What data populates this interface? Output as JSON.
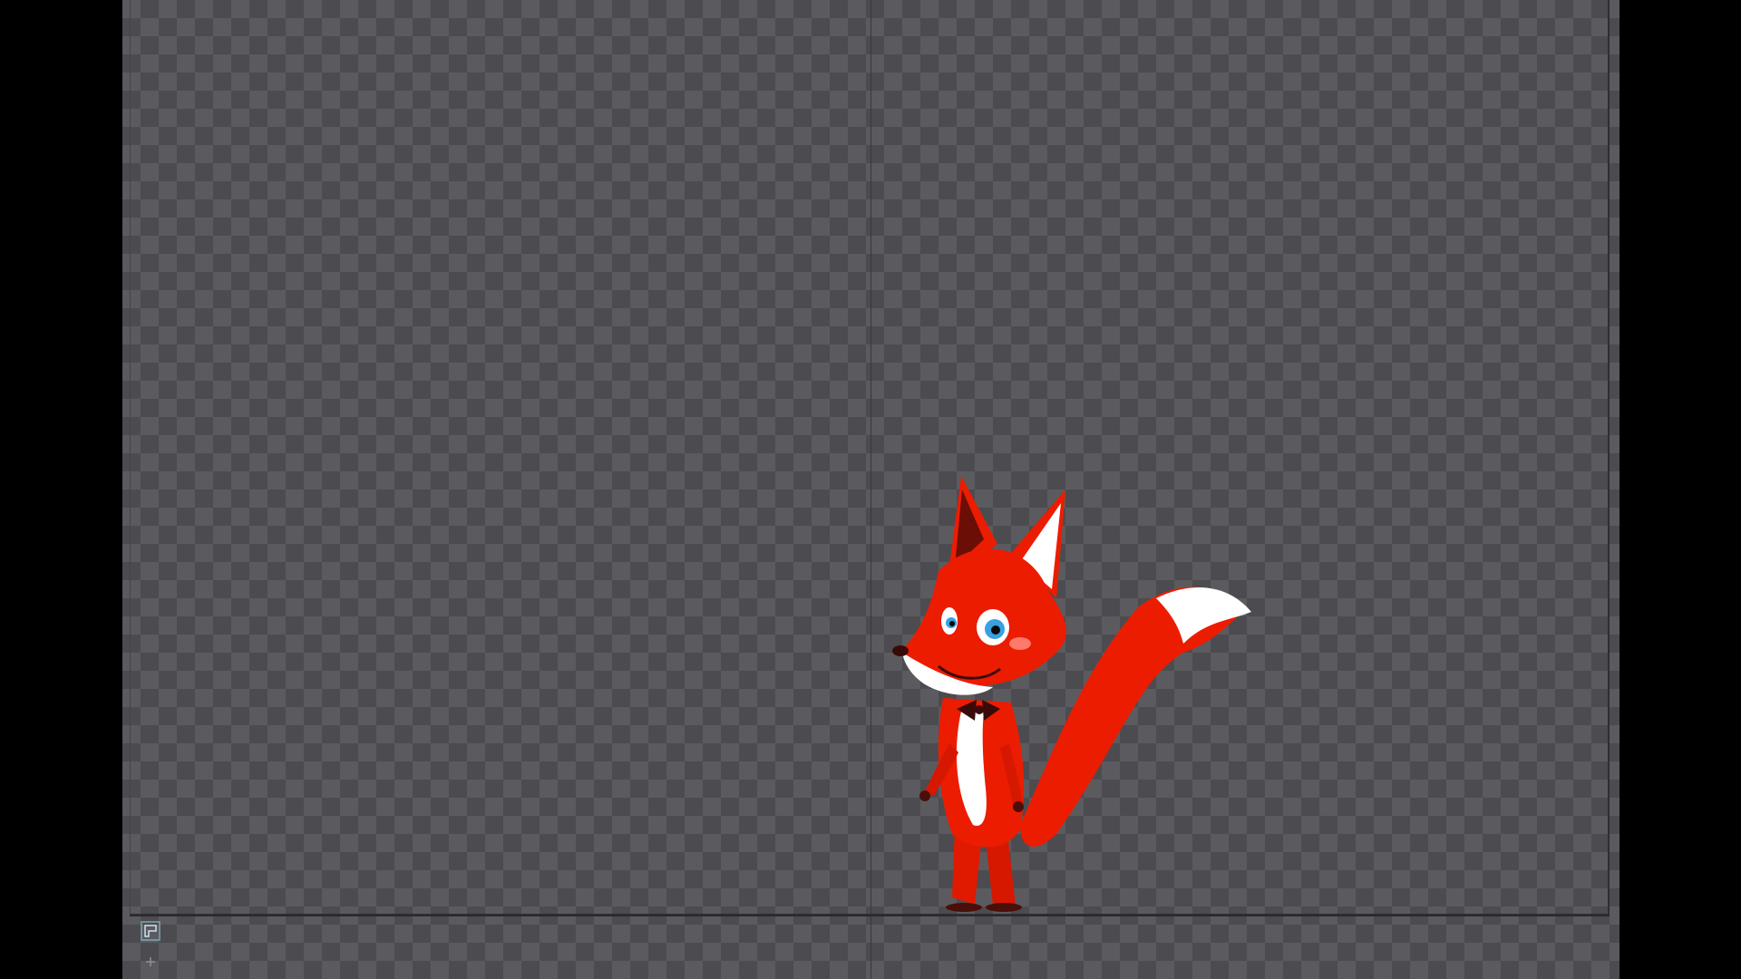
{
  "canvas": {
    "background_color": "#5b5b5f",
    "checker_color": "#4c4c50"
  },
  "character": {
    "name_icon": "fox-character",
    "body_color": "#ec1c00",
    "belly_color": "#ffffff",
    "eye_color": "#3aa0e0",
    "bowtie_color": "#3a0a0a"
  },
  "icons": {
    "bottom_tool": "origin-transform-icon",
    "bottom_add": "plus-icon"
  }
}
